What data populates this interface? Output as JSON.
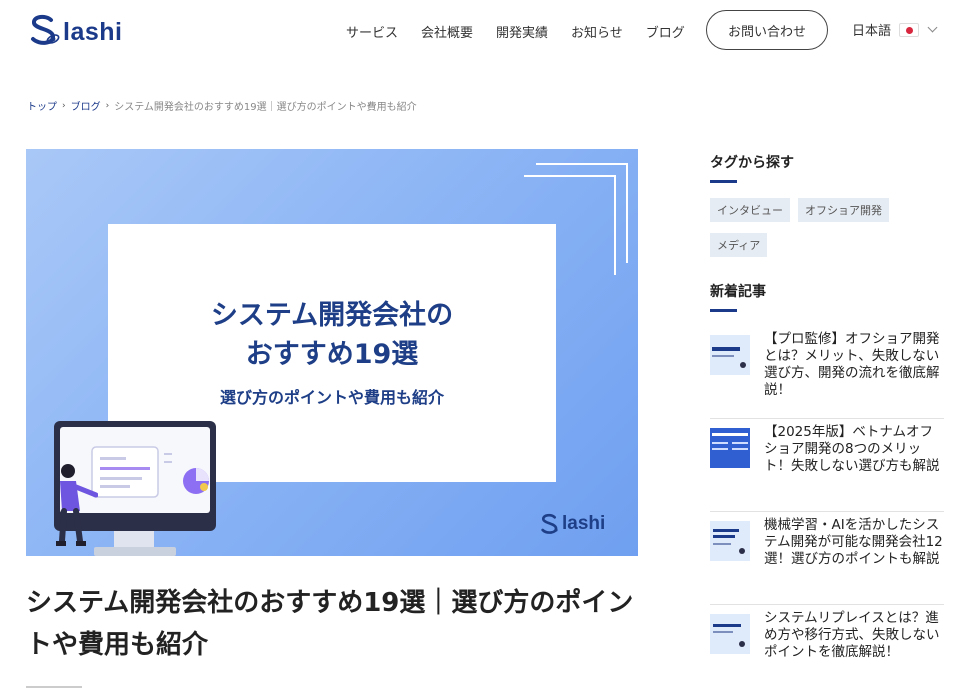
{
  "brand": {
    "name": "Solashi",
    "wordmark": "lashi",
    "color": "#1c3a8a"
  },
  "nav": {
    "items": [
      "サービス",
      "会社概要",
      "開発実績",
      "お知らせ",
      "ブログ"
    ],
    "contact_label": "お問い合わせ",
    "language_label": "日本語"
  },
  "breadcrumb": {
    "home": "トップ",
    "blog": "ブログ",
    "current": "システム開発会社のおすすめ19選｜選び方のポイントや費用も紹介"
  },
  "hero": {
    "title_line1": "システム開発会社の",
    "title_line2": "おすすめ19選",
    "subtitle": "選び方のポイントや費用も紹介",
    "logo_text": "lashi"
  },
  "article": {
    "title": "システム開発会社のおすすめ19選｜選び方のポイントや費用も紹介"
  },
  "sidebar": {
    "tags_heading": "タグから探す",
    "tags": [
      "インタビュー",
      "オフショア開発",
      "メディア"
    ],
    "recent_heading": "新着記事",
    "posts": [
      {
        "title": "【プロ監修】オフショア開発とは？メリット、失敗しない選び方、開発の流れを徹底解説！"
      },
      {
        "title": "【2025年版】ベトナムオフショア開発の8つのメリット！失敗しない選び方も解説"
      },
      {
        "title": "機械学習・AIを活かしたシステム開発が可能な開発会社12選！選び方のポイントも解説"
      },
      {
        "title": "システムリプレイスとは？進め方や移行方式、失敗しないポイントを徹底解説！"
      }
    ]
  },
  "colors": {
    "accent": "#1c3a8a",
    "hero_bg": "#8cb5f5",
    "tag_bg": "#e6ecf3"
  }
}
